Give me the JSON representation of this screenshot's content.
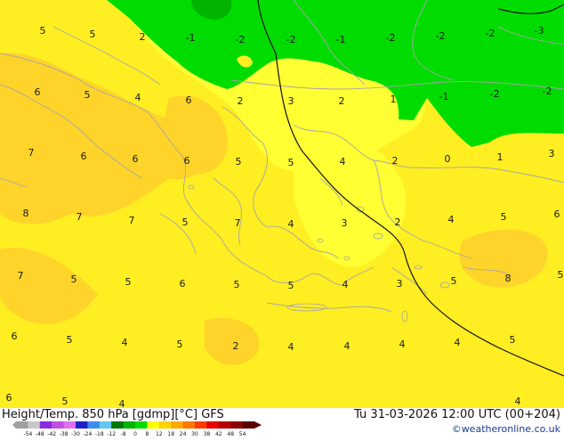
{
  "footer": {
    "title": "Height/Temp. 850 hPa [gdmp][°C] GFS",
    "datetime": "Tu 31-03-2026 12:00 UTC (00+204)",
    "copyright": "©weatheronline.co.uk"
  },
  "colorbar": {
    "ticks": [
      "-54",
      "-48",
      "-42",
      "-38",
      "-30",
      "-24",
      "-18",
      "-12",
      "-8",
      "0",
      "8",
      "12",
      "18",
      "24",
      "30",
      "38",
      "42",
      "48",
      "54"
    ],
    "colors": [
      "#a0a0a0",
      "#c8c8c8",
      "#8a2be2",
      "#c050e0",
      "#e070f0",
      "#2020c8",
      "#3c8cf0",
      "#64c8f0",
      "#007800",
      "#00b400",
      "#00dc00",
      "#ffff00",
      "#ffd200",
      "#ffaa00",
      "#ff7800",
      "#ff3c00",
      "#e60000",
      "#b40000",
      "#8c0000",
      "#5a0000"
    ]
  },
  "map": {
    "colors": {
      "green": "#00dc00",
      "dark_green": "#00b400",
      "yellow": "#ffee22",
      "light_yellow": "#ffff33",
      "orange_yellow": "#ffd42a",
      "coast": "#a6a6a6"
    },
    "labels": [
      {
        "id": "a1",
        "text": "5"
      },
      {
        "id": "a2",
        "text": "5"
      },
      {
        "id": "a3",
        "text": "2"
      },
      {
        "id": "a4",
        "text": "-1"
      },
      {
        "id": "a5",
        "text": "-2"
      },
      {
        "id": "a6",
        "text": "-2"
      },
      {
        "id": "a7",
        "text": "-1"
      },
      {
        "id": "a8",
        "text": "-2"
      },
      {
        "id": "a9",
        "text": "-2"
      },
      {
        "id": "a10",
        "text": "-2"
      },
      {
        "id": "a11",
        "text": "-3"
      },
      {
        "id": "b1",
        "text": "6"
      },
      {
        "id": "b2",
        "text": "5"
      },
      {
        "id": "b3",
        "text": "4"
      },
      {
        "id": "b4",
        "text": "6"
      },
      {
        "id": "b5",
        "text": "2"
      },
      {
        "id": "b6",
        "text": "3"
      },
      {
        "id": "b7",
        "text": "2"
      },
      {
        "id": "b8",
        "text": "1"
      },
      {
        "id": "b9",
        "text": "-1"
      },
      {
        "id": "b10",
        "text": "-2"
      },
      {
        "id": "b11",
        "text": "-2"
      },
      {
        "id": "c1",
        "text": "7"
      },
      {
        "id": "c2",
        "text": "6"
      },
      {
        "id": "c3",
        "text": "6"
      },
      {
        "id": "c4",
        "text": "6"
      },
      {
        "id": "c5",
        "text": "5"
      },
      {
        "id": "c6",
        "text": "5"
      },
      {
        "id": "c7",
        "text": "4"
      },
      {
        "id": "c8",
        "text": "2"
      },
      {
        "id": "c9",
        "text": "0"
      },
      {
        "id": "c10",
        "text": "1"
      },
      {
        "id": "c11",
        "text": "3"
      },
      {
        "id": "d1",
        "text": "8"
      },
      {
        "id": "d2",
        "text": "7"
      },
      {
        "id": "d3",
        "text": "7"
      },
      {
        "id": "d4",
        "text": "5"
      },
      {
        "id": "d5",
        "text": "7"
      },
      {
        "id": "d6",
        "text": "4"
      },
      {
        "id": "d7",
        "text": "3"
      },
      {
        "id": "d8",
        "text": "2"
      },
      {
        "id": "d9",
        "text": "4"
      },
      {
        "id": "d10",
        "text": "5"
      },
      {
        "id": "d11",
        "text": "6"
      },
      {
        "id": "e1",
        "text": "7"
      },
      {
        "id": "e2",
        "text": "5"
      },
      {
        "id": "e3",
        "text": "5"
      },
      {
        "id": "e4",
        "text": "6"
      },
      {
        "id": "e5",
        "text": "5"
      },
      {
        "id": "e6",
        "text": "5"
      },
      {
        "id": "e7",
        "text": "4"
      },
      {
        "id": "e8",
        "text": "3"
      },
      {
        "id": "e9",
        "text": "5"
      },
      {
        "id": "e10",
        "text": "8"
      },
      {
        "id": "e11",
        "text": "5"
      },
      {
        "id": "f1",
        "text": "6"
      },
      {
        "id": "f2",
        "text": "5"
      },
      {
        "id": "f3",
        "text": "4"
      },
      {
        "id": "f4",
        "text": "5"
      },
      {
        "id": "f5",
        "text": "2"
      },
      {
        "id": "f6",
        "text": "4"
      },
      {
        "id": "f7",
        "text": "4"
      },
      {
        "id": "f8",
        "text": "4"
      },
      {
        "id": "f9",
        "text": "4"
      },
      {
        "id": "f10",
        "text": "5"
      },
      {
        "id": "g1",
        "text": "6"
      },
      {
        "id": "g2",
        "text": "5"
      },
      {
        "id": "g3",
        "text": "4"
      },
      {
        "id": "g4",
        "text": "4"
      }
    ]
  }
}
